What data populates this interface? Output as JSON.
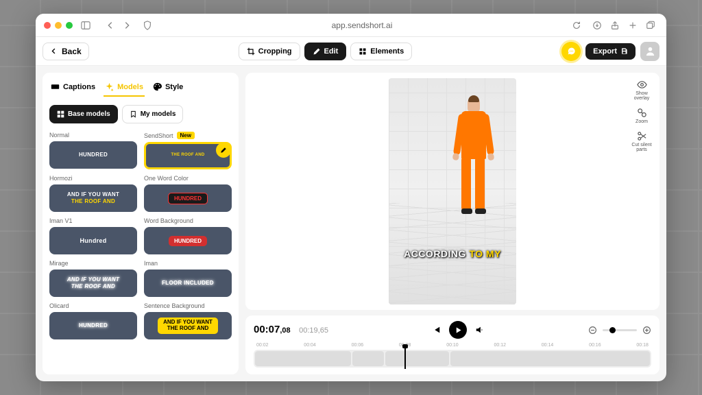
{
  "url": "app.sendshort.ai",
  "back_label": "Back",
  "mode_tabs": {
    "cropping": "Cropping",
    "edit": "Edit",
    "elements": "Elements"
  },
  "export_label": "Export",
  "sidebar_tabs": {
    "captions": "Captions",
    "models": "Models",
    "style": "Style"
  },
  "model_types": {
    "base": "Base models",
    "my": "My models"
  },
  "models": {
    "normal": {
      "label": "Normal",
      "text": "HUNDRED"
    },
    "sendshort": {
      "label": "SendShort",
      "badge": "New",
      "text": "THE ROOF AND"
    },
    "hormozi": {
      "label": "Hormozi",
      "line1": "AND IF YOU WANT",
      "line2": "THE ROOF AND"
    },
    "onewordcolor": {
      "label": "One Word Color",
      "text": "HUNDRED"
    },
    "imanv1": {
      "label": "Iman V1",
      "text": "Hundred"
    },
    "wordbg": {
      "label": "Word Background",
      "text": "HUNDRED"
    },
    "mirage": {
      "label": "Mirage",
      "line1": "AND IF YOU WANT",
      "line2": "THE ROOF AND"
    },
    "iman": {
      "label": "Iman",
      "text": "FLOOR INCLUDED"
    },
    "olicard": {
      "label": "Olicard",
      "text": "HUNDRED"
    },
    "sentencebg": {
      "label": "Sentence Background",
      "line1": "AND IF YOU WANT",
      "line2": "THE ROOF AND"
    }
  },
  "caption": {
    "word1": "ACCORDING",
    "word2": "TO MY"
  },
  "side_tools": {
    "overlay": "Show overlay",
    "zoom": "Zoom",
    "cut": "Cut silent parts"
  },
  "time": {
    "current": "00:07",
    "frac": ",08",
    "total": "00:19,65"
  },
  "ruler": [
    "00:02",
    "00:04",
    "00:06",
    "00:08",
    "00:10",
    "00:12",
    "00:14",
    "00:16",
    "00:18"
  ]
}
